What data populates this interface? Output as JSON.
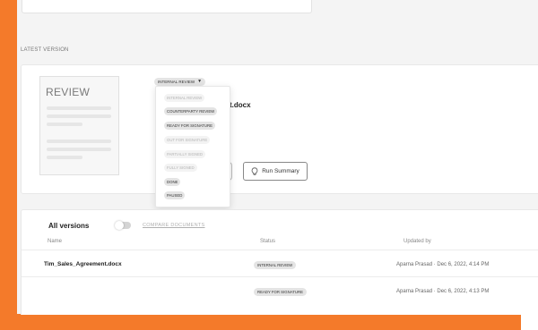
{
  "latest_version": {
    "section_label": "LATEST VERSION",
    "preview_title": "REVIEW",
    "status": "INTERNAL REVIEW",
    "file_name_visible": "t.docx",
    "run_summary_label": "Run Summary"
  },
  "status_dropdown": {
    "options": [
      {
        "label": "INTERNAL REVIEW",
        "enabled": false
      },
      {
        "label": "COUNTERPARTY REVIEW",
        "enabled": true
      },
      {
        "label": "READY FOR SIGNATURE",
        "enabled": true
      },
      {
        "label": "OUT FOR SIGNATURE",
        "enabled": false
      },
      {
        "label": "PARTIALLY SIGNED",
        "enabled": false
      },
      {
        "label": "FULLY SIGNED",
        "enabled": false
      },
      {
        "label": "DONE",
        "enabled": true
      },
      {
        "label": "PAUSED",
        "enabled": true
      }
    ]
  },
  "all_versions": {
    "title": "All versions",
    "compare_label": "COMPARE DOCUMENTS",
    "columns": {
      "name": "Name",
      "status": "Status",
      "updated": "Updated by"
    },
    "rows": [
      {
        "name": "Tim_Sales_Agreement.docx",
        "status": "INTERNAL REVIEW",
        "updated": "Aparna Prasad · Dec 6, 2022, 4:14 PM"
      },
      {
        "name": "",
        "status": "READY FOR SIGNATURE",
        "updated": "Aparna Prasad · Dec 6, 2022, 4:13 PM"
      }
    ]
  },
  "colors": {
    "accent": "#f47a2a",
    "canvas": "#f4f4f4",
    "pill": "#e4e4e4"
  },
  "icons": {
    "status_chevron": "chevron-down-icon",
    "run_summary": "lightbulb-icon"
  }
}
